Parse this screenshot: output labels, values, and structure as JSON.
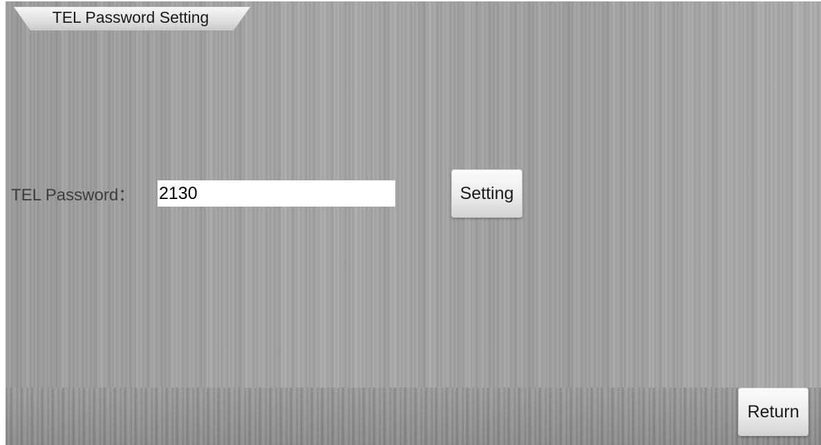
{
  "window": {
    "title": "TEL Password Setting"
  },
  "form": {
    "password_label": "TEL Password：",
    "password_value": "2130"
  },
  "buttons": {
    "setting_label": "Setting",
    "return_label": "Return"
  },
  "colors": {
    "background": "#a3a4a3",
    "bottom_bar": "#8f908f",
    "input_background": "#ffffff",
    "label_text": "#3c3c3c"
  }
}
